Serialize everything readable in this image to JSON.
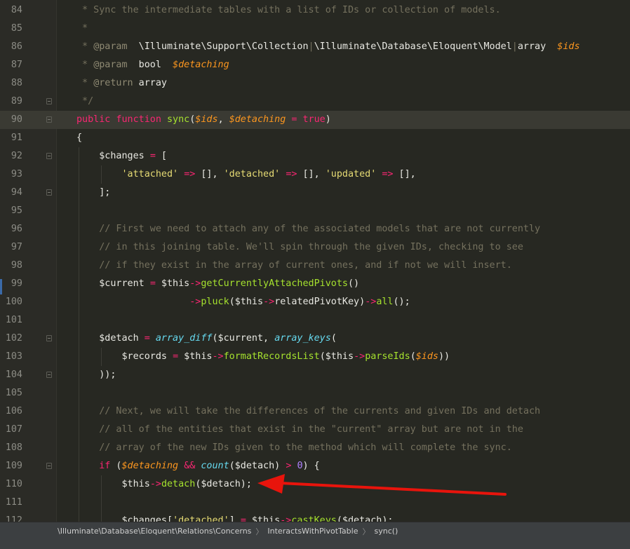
{
  "colors": {
    "background": "#272822",
    "comment": "#75715e",
    "keyword": "#f92672",
    "function": "#a6e22e",
    "variable": "#fd971f",
    "string": "#e6db74",
    "number": "#ae81ff",
    "builtin": "#66d9ef",
    "annotation_arrow": "#e8140c"
  },
  "editor": {
    "current_line": 90,
    "lines": [
      {
        "n": "84",
        "fold": false,
        "tokens": [
          [
            "doc",
            " * Sync the intermediate tables with a list of IDs or collection of models."
          ]
        ]
      },
      {
        "n": "85",
        "fold": false,
        "tokens": [
          [
            "doc",
            " *"
          ]
        ]
      },
      {
        "n": "86",
        "fold": false,
        "tokens": [
          [
            "doc",
            " * "
          ],
          [
            "tag",
            "@param"
          ],
          [
            "plain",
            "  \\Illuminate\\Support\\Collection"
          ],
          [
            "doc",
            "|"
          ],
          [
            "plain",
            "\\Illuminate\\Database\\Eloquent\\Model"
          ],
          [
            "doc",
            "|"
          ],
          [
            "plain",
            "array  "
          ],
          [
            "var",
            "$ids"
          ]
        ]
      },
      {
        "n": "87",
        "fold": false,
        "tokens": [
          [
            "doc",
            " * "
          ],
          [
            "tag",
            "@param"
          ],
          [
            "plain",
            "  bool  "
          ],
          [
            "var",
            "$detaching"
          ]
        ]
      },
      {
        "n": "88",
        "fold": false,
        "tokens": [
          [
            "doc",
            " * "
          ],
          [
            "tag",
            "@return"
          ],
          [
            "plain",
            " array"
          ]
        ]
      },
      {
        "n": "89",
        "fold": true,
        "tokens": [
          [
            "doc",
            " */"
          ]
        ]
      },
      {
        "n": "90",
        "fold": true,
        "current": true,
        "tokens": [
          [
            "kw",
            "public"
          ],
          [
            "plain",
            " "
          ],
          [
            "kw",
            "function"
          ],
          [
            "plain",
            " "
          ],
          [
            "fn",
            "sync"
          ],
          [
            "plain",
            "("
          ],
          [
            "var",
            "$ids"
          ],
          [
            "plain",
            ", "
          ],
          [
            "var",
            "$detaching"
          ],
          [
            "plain",
            " "
          ],
          [
            "op",
            "="
          ],
          [
            "plain",
            " "
          ],
          [
            "kw",
            "true"
          ],
          [
            "plain",
            ")"
          ]
        ]
      },
      {
        "n": "91",
        "fold": false,
        "tokens": [
          [
            "plain",
            "{"
          ]
        ]
      },
      {
        "n": "92",
        "fold": true,
        "indent": 1,
        "tokens": [
          [
            "plain",
            "    $changes "
          ],
          [
            "op",
            "="
          ],
          [
            "plain",
            " ["
          ]
        ]
      },
      {
        "n": "93",
        "fold": false,
        "indent": 2,
        "tokens": [
          [
            "plain",
            "        "
          ],
          [
            "str",
            "'attached'"
          ],
          [
            "plain",
            " "
          ],
          [
            "op",
            "=>"
          ],
          [
            "plain",
            " [], "
          ],
          [
            "str",
            "'detached'"
          ],
          [
            "plain",
            " "
          ],
          [
            "op",
            "=>"
          ],
          [
            "plain",
            " [], "
          ],
          [
            "str",
            "'updated'"
          ],
          [
            "plain",
            " "
          ],
          [
            "op",
            "=>"
          ],
          [
            "plain",
            " [],"
          ]
        ]
      },
      {
        "n": "94",
        "fold": true,
        "indent": 1,
        "tokens": [
          [
            "plain",
            "    ];"
          ]
        ]
      },
      {
        "n": "95",
        "fold": false,
        "indent": 1,
        "tokens": []
      },
      {
        "n": "96",
        "fold": false,
        "indent": 1,
        "tokens": [
          [
            "comment",
            "    // First we need to attach any of the associated models that are not currently"
          ]
        ]
      },
      {
        "n": "97",
        "fold": false,
        "indent": 1,
        "tokens": [
          [
            "comment",
            "    // in this joining table. We'll spin through the given IDs, checking to see"
          ]
        ]
      },
      {
        "n": "98",
        "fold": false,
        "indent": 1,
        "tokens": [
          [
            "comment",
            "    // if they exist in the array of current ones, and if not we will insert."
          ]
        ]
      },
      {
        "n": "99",
        "fold": false,
        "indent": 1,
        "tokens": [
          [
            "plain",
            "    $current "
          ],
          [
            "op",
            "="
          ],
          [
            "plain",
            " $this"
          ],
          [
            "op",
            "->"
          ],
          [
            "fn",
            "getCurrentlyAttachedPivots"
          ],
          [
            "plain",
            "()"
          ]
        ]
      },
      {
        "n": "100",
        "fold": false,
        "indent": 1,
        "tokens": [
          [
            "plain",
            "                    "
          ],
          [
            "op",
            "->"
          ],
          [
            "fn",
            "pluck"
          ],
          [
            "plain",
            "($this"
          ],
          [
            "op",
            "->"
          ],
          [
            "plain",
            "relatedPivotKey)"
          ],
          [
            "op",
            "->"
          ],
          [
            "fn",
            "all"
          ],
          [
            "plain",
            "();"
          ]
        ]
      },
      {
        "n": "101",
        "fold": false,
        "indent": 1,
        "tokens": []
      },
      {
        "n": "102",
        "fold": true,
        "indent": 1,
        "tokens": [
          [
            "plain",
            "    $detach "
          ],
          [
            "op",
            "="
          ],
          [
            "plain",
            " "
          ],
          [
            "builtin",
            "array_diff"
          ],
          [
            "plain",
            "($current, "
          ],
          [
            "builtin",
            "array_keys"
          ],
          [
            "plain",
            "("
          ]
        ]
      },
      {
        "n": "103",
        "fold": false,
        "indent": 2,
        "tokens": [
          [
            "plain",
            "        $records "
          ],
          [
            "op",
            "="
          ],
          [
            "plain",
            " $this"
          ],
          [
            "op",
            "->"
          ],
          [
            "fn",
            "formatRecordsList"
          ],
          [
            "plain",
            "($this"
          ],
          [
            "op",
            "->"
          ],
          [
            "fn",
            "parseIds"
          ],
          [
            "plain",
            "("
          ],
          [
            "var",
            "$ids"
          ],
          [
            "plain",
            "))"
          ]
        ]
      },
      {
        "n": "104",
        "fold": true,
        "indent": 1,
        "tokens": [
          [
            "plain",
            "    ));"
          ]
        ]
      },
      {
        "n": "105",
        "fold": false,
        "indent": 1,
        "tokens": []
      },
      {
        "n": "106",
        "fold": false,
        "indent": 1,
        "tokens": [
          [
            "comment",
            "    // Next, we will take the differences of the currents and given IDs and detach"
          ]
        ]
      },
      {
        "n": "107",
        "fold": false,
        "indent": 1,
        "tokens": [
          [
            "comment",
            "    // all of the entities that exist in the \"current\" array but are not in the"
          ]
        ]
      },
      {
        "n": "108",
        "fold": false,
        "indent": 1,
        "tokens": [
          [
            "comment",
            "    // array of the new IDs given to the method which will complete the sync."
          ]
        ]
      },
      {
        "n": "109",
        "fold": true,
        "indent": 1,
        "tokens": [
          [
            "plain",
            "    "
          ],
          [
            "kw",
            "if"
          ],
          [
            "plain",
            " ("
          ],
          [
            "var",
            "$detaching"
          ],
          [
            "plain",
            " "
          ],
          [
            "op",
            "&&"
          ],
          [
            "plain",
            " "
          ],
          [
            "builtin",
            "count"
          ],
          [
            "plain",
            "($detach) "
          ],
          [
            "op",
            ">"
          ],
          [
            "plain",
            " "
          ],
          [
            "num",
            "0"
          ],
          [
            "plain",
            ") {"
          ]
        ]
      },
      {
        "n": "110",
        "fold": false,
        "indent": 2,
        "tokens": [
          [
            "plain",
            "        $this"
          ],
          [
            "op",
            "->"
          ],
          [
            "fn",
            "detach"
          ],
          [
            "plain",
            "($detach);"
          ]
        ]
      },
      {
        "n": "111",
        "fold": false,
        "indent": 2,
        "tokens": []
      },
      {
        "n": "112",
        "fold": false,
        "indent": 2,
        "tokens": [
          [
            "plain",
            "        $changes["
          ],
          [
            "str",
            "'detached'"
          ],
          [
            "plain",
            "] "
          ],
          [
            "op",
            "="
          ],
          [
            "plain",
            " $this"
          ],
          [
            "op",
            "->"
          ],
          [
            "fn",
            "castKeys"
          ],
          [
            "plain",
            "($detach);"
          ]
        ]
      }
    ]
  },
  "breadcrumb": {
    "items": [
      "\\Illuminate\\Database\\Eloquent\\Relations\\Concerns",
      "InteractsWithPivotTable",
      "sync()"
    ],
    "separator": "〉"
  },
  "annotation": {
    "icon": "red-arrow-icon",
    "points_to_line": 110
  }
}
